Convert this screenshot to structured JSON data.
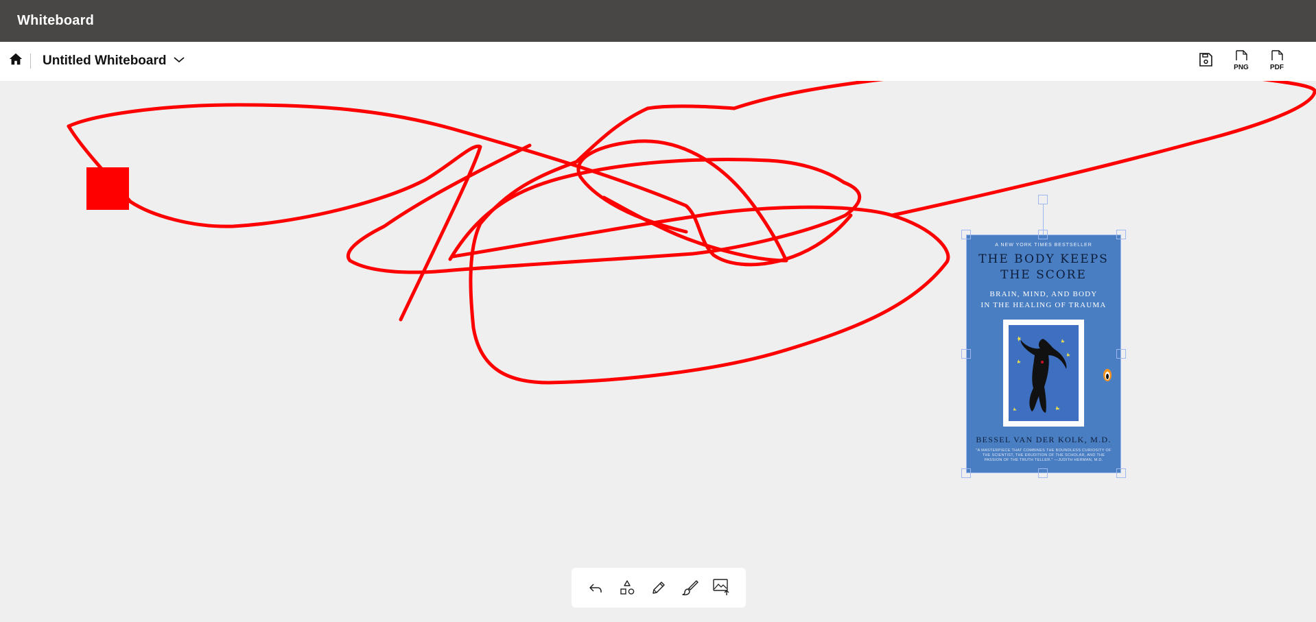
{
  "app": {
    "title": "Whiteboard"
  },
  "toolbar": {
    "home_icon": "home-icon",
    "document_title": "Untitled Whiteboard",
    "title_dropdown_icon": "chevron-down-icon",
    "export": [
      {
        "name": "save",
        "icon": "save-icon",
        "label": ""
      },
      {
        "name": "png",
        "icon": "file-png-icon",
        "label": "PNG"
      },
      {
        "name": "pdf",
        "icon": "file-pdf-icon",
        "label": "PDF"
      }
    ]
  },
  "canvas": {
    "stroke_color": "#ff0000",
    "shape_color": "#ff0000",
    "selection_color": "#9fb8f0",
    "image": {
      "kind": "book-cover",
      "top_line": "A NEW YORK TIMES BESTSELLER",
      "title_line1": "THE BODY KEEPS",
      "title_line2": "THE SCORE",
      "subtitle_line1": "BRAIN, MIND, AND BODY",
      "subtitle_line2": "IN THE HEALING OF TRAUMA",
      "author": "BESSEL VAN DER KOLK, M.D.",
      "blurb": "\"A MASTERPIECE THAT COMBINES THE BOUNDLESS CURIOSITY OF THE SCIENTIST, THE ERUDITION OF THE SCHOLAR, AND THE PASSION OF THE TRUTH TELLER.\" —JUDITH HERMAN, M.D.",
      "cover_color": "#4a7ec2"
    }
  },
  "bottom_toolbar": {
    "tools": [
      {
        "name": "undo",
        "icon": "undo-icon"
      },
      {
        "name": "shapes",
        "icon": "shapes-icon"
      },
      {
        "name": "pencil",
        "icon": "pencil-icon"
      },
      {
        "name": "brush",
        "icon": "brush-icon"
      },
      {
        "name": "image-upload",
        "icon": "image-upload-icon"
      }
    ]
  }
}
